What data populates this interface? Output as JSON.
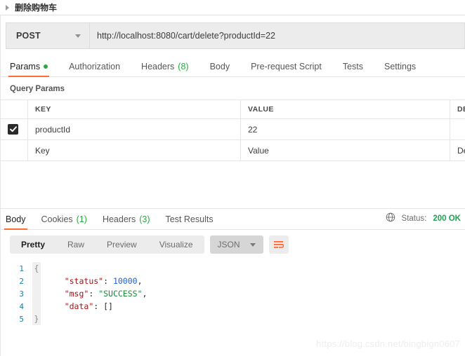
{
  "request_header": {
    "title": "删除购物车",
    "collapse_icon": "triangle-right-icon"
  },
  "urlbar": {
    "method": "POST",
    "method_caret_icon": "chevron-down-icon",
    "url": "http://localhost:8080/cart/delete?productId=22"
  },
  "request_tabs": [
    {
      "label": "Params",
      "badge": "",
      "dot": true,
      "active": true
    },
    {
      "label": "Authorization",
      "badge": "",
      "dot": false,
      "active": false
    },
    {
      "label": "Headers",
      "badge": "(8)",
      "dot": false,
      "active": false
    },
    {
      "label": "Body",
      "badge": "",
      "dot": false,
      "active": false
    },
    {
      "label": "Pre-request Script",
      "badge": "",
      "dot": false,
      "active": false
    },
    {
      "label": "Tests",
      "badge": "",
      "dot": false,
      "active": false
    },
    {
      "label": "Settings",
      "badge": "",
      "dot": false,
      "active": false
    }
  ],
  "query_params": {
    "section_label": "Query Params",
    "columns": [
      "KEY",
      "VALUE",
      "DESCRIPTION"
    ],
    "rows": [
      {
        "checked": true,
        "key": "productId",
        "value": "22",
        "description": ""
      }
    ],
    "placeholder_row": {
      "key": "Key",
      "value": "Value",
      "description": "Description"
    }
  },
  "response_tabs": [
    {
      "label": "Body",
      "badge": "",
      "active": true
    },
    {
      "label": "Cookies",
      "badge": "(1)",
      "active": false
    },
    {
      "label": "Headers",
      "badge": "(3)",
      "active": false
    },
    {
      "label": "Test Results",
      "badge": "",
      "active": false
    }
  ],
  "response_status": {
    "globe_icon": "globe-icon",
    "label": "Status:",
    "value": "200 OK"
  },
  "view_bar": {
    "modes": [
      "Pretty",
      "Raw",
      "Preview",
      "Visualize"
    ],
    "active_mode": "Pretty",
    "format": "JSON",
    "format_caret_icon": "chevron-down-icon",
    "wrap_icon": "word-wrap-icon"
  },
  "response_body": {
    "lines": [
      {
        "no": "1",
        "fold": "{",
        "segments": []
      },
      {
        "no": "2",
        "fold": "",
        "segments": [
          {
            "t": "    ",
            "c": "punc"
          },
          {
            "t": "\"status\"",
            "c": "k-str"
          },
          {
            "t": ": ",
            "c": "punc"
          },
          {
            "t": "10000",
            "c": "v-num"
          },
          {
            "t": ",",
            "c": "punc"
          }
        ]
      },
      {
        "no": "3",
        "fold": "",
        "segments": [
          {
            "t": "    ",
            "c": "punc"
          },
          {
            "t": "\"msg\"",
            "c": "k-str"
          },
          {
            "t": ": ",
            "c": "punc"
          },
          {
            "t": "\"SUCCESS\"",
            "c": "v-str"
          },
          {
            "t": ",",
            "c": "punc"
          }
        ]
      },
      {
        "no": "4",
        "fold": "",
        "segments": [
          {
            "t": "    ",
            "c": "punc"
          },
          {
            "t": "\"data\"",
            "c": "k-str"
          },
          {
            "t": ": ",
            "c": "punc"
          },
          {
            "t": "[]",
            "c": "punc"
          }
        ]
      },
      {
        "no": "5",
        "fold": "}",
        "segments": []
      }
    ]
  },
  "watermark": "https://blog.csdn.net/bingbign0607",
  "colors": {
    "accent": "#ff6c37",
    "success_green": "#2aa745",
    "status_green": "#1fa251",
    "json_key": "#a31515",
    "json_string": "#1a8a3a",
    "json_number": "#1c5fd6",
    "lineno": "#1a7fa8"
  }
}
